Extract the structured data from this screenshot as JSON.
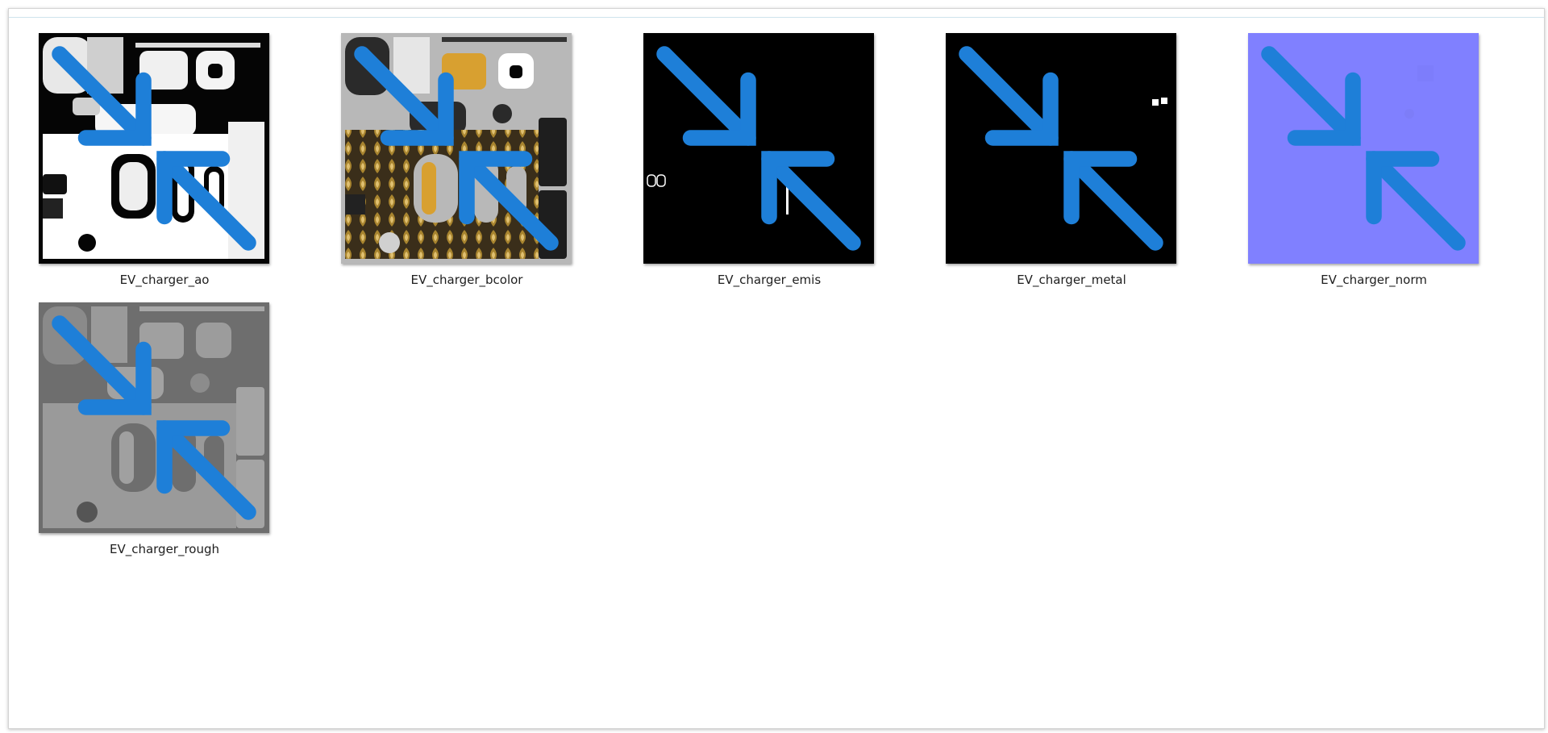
{
  "files": [
    {
      "name": "EV_charger_ao",
      "kind": "ao",
      "icon": "compress-arrows-icon"
    },
    {
      "name": "EV_charger_bcolor",
      "kind": "bcolor",
      "icon": "compress-arrows-icon"
    },
    {
      "name": "EV_charger_emis",
      "kind": "emis",
      "icon": "compress-arrows-icon"
    },
    {
      "name": "EV_charger_metal",
      "kind": "metal",
      "icon": "compress-arrows-icon"
    },
    {
      "name": "EV_charger_norm",
      "kind": "norm",
      "icon": "compress-arrows-icon"
    },
    {
      "name": "EV_charger_rough",
      "kind": "rough",
      "icon": "compress-arrows-icon"
    }
  ],
  "colors": {
    "accent": "#1e7fd8",
    "normal_map": "#8080ff",
    "bcolor_bg": "#b8b8b8",
    "rough_bg": "#6e6e6e",
    "gold": "#d8a030"
  }
}
